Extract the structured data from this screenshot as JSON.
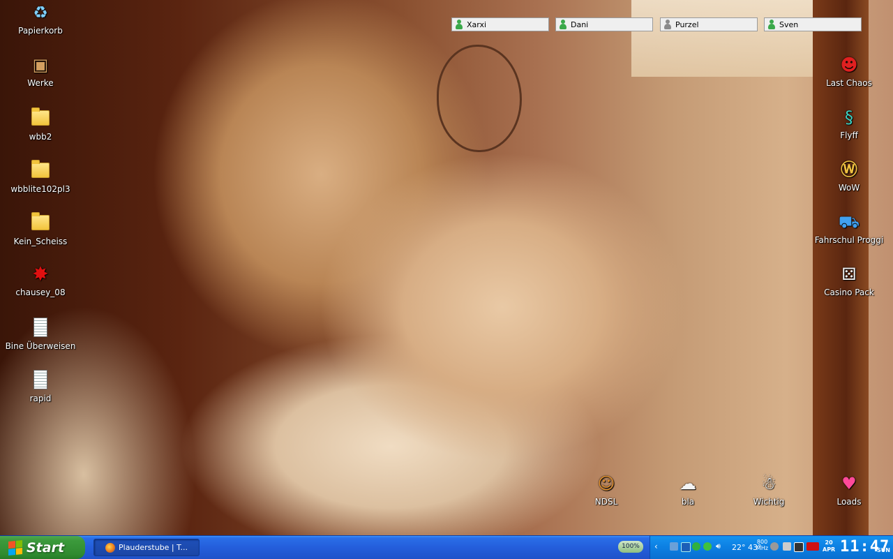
{
  "desktop": {
    "left_icons": [
      {
        "label": "Papierkorb",
        "icon": "recycle-bin-icon"
      },
      {
        "label": "Werke",
        "icon": "package-icon"
      },
      {
        "label": "wbb2",
        "icon": "folder-icon"
      },
      {
        "label": "wbblite102pl3",
        "icon": "folder-icon"
      },
      {
        "label": "Kein_Scheiss",
        "icon": "folder-icon"
      },
      {
        "label": "chausey_08",
        "icon": "red-splat-icon"
      },
      {
        "label": "Bine Überweisen",
        "icon": "text-document-icon"
      },
      {
        "label": "rapid",
        "icon": "text-document-icon"
      }
    ],
    "right_icons": [
      {
        "label": "Last Chaos",
        "icon": "red-devil-icon"
      },
      {
        "label": "Flyff",
        "icon": "snake-icon"
      },
      {
        "label": "WoW",
        "icon": "wow-logo-icon"
      },
      {
        "label": "Fahrschul Proggi",
        "icon": "car-icon"
      },
      {
        "label": "Casino Pack",
        "icon": "dice-icon"
      }
    ],
    "bottom_icons": [
      {
        "label": "NDSL",
        "icon": "cat-icon"
      },
      {
        "label": "bla",
        "icon": "sheep-icon"
      },
      {
        "label": "Wichtig",
        "icon": "rabbit-icon"
      },
      {
        "label": "Loads",
        "icon": "heart-icon"
      }
    ]
  },
  "contacts": [
    {
      "name": "Xarxi",
      "status_color": "#3aa84a"
    },
    {
      "name": "Dani",
      "status_color": "#3aa84a"
    },
    {
      "name": "Purzel",
      "status_color": "#8a8a8a"
    },
    {
      "name": "Sven",
      "status_color": "#3aa84a"
    }
  ],
  "taskbar": {
    "start_label": "Start",
    "task_label": "Plauderstube | T...",
    "zoom": "100%",
    "tray": {
      "temps": "22° 43°",
      "cpu_value": "800",
      "cpu_unit": "MHz",
      "date_day": "20",
      "date_month": "APR",
      "time": "11:47",
      "weekday": "SUN"
    }
  },
  "colors": {
    "taskbar_blue": "#245edb",
    "start_green": "#3c9a3c",
    "tray_blue": "#0c7fe2"
  }
}
